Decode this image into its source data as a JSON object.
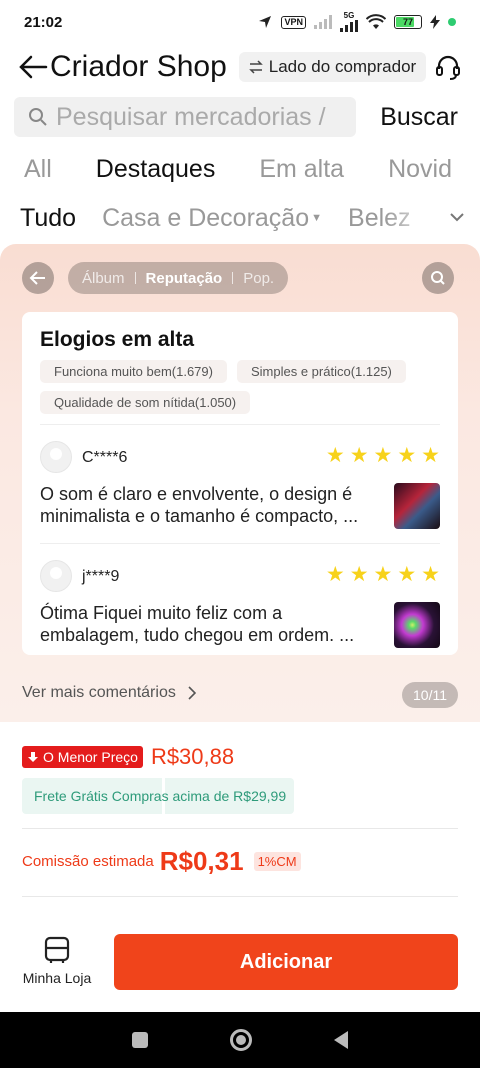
{
  "status_bar": {
    "time": "21:02",
    "vpn_label": "VPN",
    "network_label": "5G",
    "battery_level": "77"
  },
  "header": {
    "title": "Criador Shop",
    "buyer_side_label": "Lado do comprador"
  },
  "search": {
    "placeholder": "Pesquisar mercadorias /",
    "button_label": "Buscar"
  },
  "tabs": [
    {
      "label": "All",
      "active": false
    },
    {
      "label": "Destaques",
      "active": true
    },
    {
      "label": "Em alta",
      "active": false
    },
    {
      "label": "Novid",
      "active": false
    }
  ],
  "subcategories": [
    {
      "label": "Tudo",
      "active": true
    },
    {
      "label": "Casa e Decoração",
      "active": false
    },
    {
      "label": "Belez",
      "active": false
    }
  ],
  "review_nav": {
    "segments": [
      "Álbum",
      "Reputação",
      "Pop."
    ],
    "active_segment": "Reputação"
  },
  "praise": {
    "title": "Elogios em alta",
    "tags": [
      "Funciona muito bem(1.679)",
      "Simples e prático(1.125)",
      "Qualidade de som nítida(1.050)"
    ]
  },
  "reviews": [
    {
      "user": "C****6",
      "stars": 5,
      "text": "O som é claro e envolvente, o design é minimalista e o tamanho é compacto, ..."
    },
    {
      "user": "j****9",
      "stars": 5,
      "text": "Ótima Fiquei muito feliz com a embalagem, tudo chegou em ordem. ..."
    }
  ],
  "more_comments_label": "Ver mais comentários",
  "pager": "10/11",
  "pricing": {
    "lowest_badge": "O Menor Preço",
    "price": "R$30,88",
    "free_shipping": "Frete Grátis Compras acima de R$29,99",
    "commission_label": "Comissão estimada",
    "commission_value": "R$0,31",
    "commission_rate": "1%CM"
  },
  "bottom": {
    "my_store_label": "Minha Loja",
    "add_button_label": "Adicionar"
  },
  "colors": {
    "accent": "#f0441b",
    "price_red": "#ee3a18",
    "badge_red": "#e41c1c",
    "star_yellow": "#f7d21b",
    "free_ship_green": "#2e9b7a"
  }
}
